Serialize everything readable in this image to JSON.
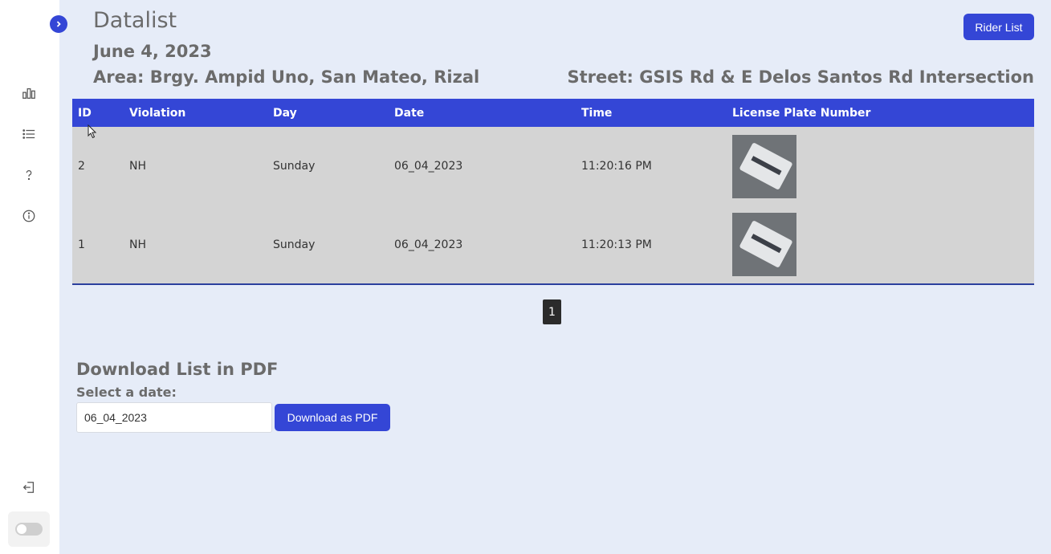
{
  "sidebar": {
    "icons": [
      "collapse-arrow-icon",
      "bar-chart-icon",
      "list-icon",
      "help-icon",
      "info-icon",
      "logout-icon"
    ],
    "theme_toggle": "off"
  },
  "header": {
    "title": "Datalist",
    "date": "June 4, 2023",
    "area": "Area: Brgy. Ampid Uno, San Mateo, Rizal",
    "street": "Street: GSIS Rd & E Delos Santos Rd Intersection",
    "rider_list_button": "Rider List"
  },
  "table": {
    "columns": [
      "ID",
      "Violation",
      "Day",
      "Date",
      "Time",
      "License Plate Number"
    ],
    "rows": [
      {
        "id": "2",
        "violation": "NH",
        "day": "Sunday",
        "date": "06_04_2023",
        "time": "11:20:16 PM"
      },
      {
        "id": "1",
        "violation": "NH",
        "day": "Sunday",
        "date": "06_04_2023",
        "time": "11:20:13 PM"
      }
    ]
  },
  "pagination": {
    "current_page": "1"
  },
  "download": {
    "title": "Download List in PDF",
    "label": "Select a date:",
    "date_value": "06_04_2023",
    "button": "Download as PDF"
  },
  "colors": {
    "accent": "#3446d6",
    "row_bg": "#d4d4d4",
    "page_bg": "#e6ecf8"
  }
}
